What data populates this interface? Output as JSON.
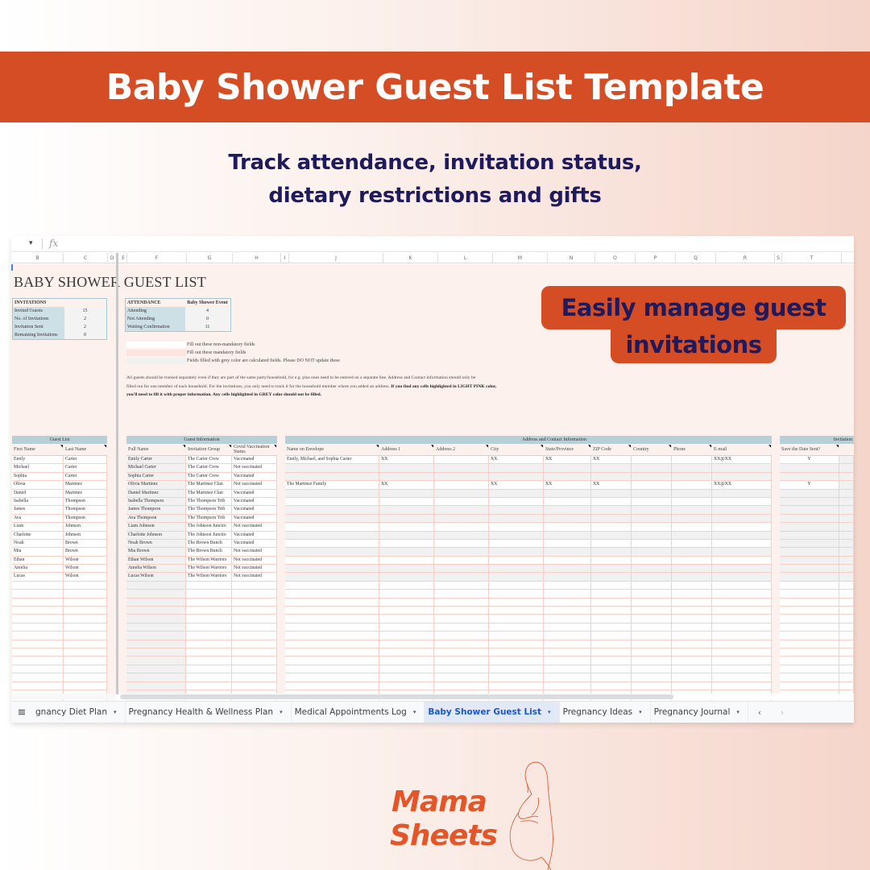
{
  "banner": {
    "title": "Baby Shower Guest List Template"
  },
  "subtitle": {
    "line1": "Track attendance, invitation status,",
    "line2": "dietary restrictions and gifts"
  },
  "callout": {
    "line1": "Easily manage guest",
    "line2": "invitations"
  },
  "colors": {
    "accent": "#d44d25",
    "navy": "#1f1a5c",
    "header_teal": "#b7d0d7",
    "mandatory_pink": "#fde4df",
    "calculated_grey": "#f1f1f1"
  },
  "formula_bar": {
    "fx_label": "fx",
    "namebox_caret": "▾"
  },
  "columns": [
    "B",
    "C",
    "D",
    "E",
    "F",
    "G",
    "H",
    "I",
    "J",
    "K",
    "L",
    "M",
    "N",
    "O",
    "P",
    "Q",
    "R",
    "S",
    "T"
  ],
  "sheet": {
    "title": "BABY SHOWER  GUEST LIST",
    "invitations": {
      "header": "INVITATIONS",
      "rows": [
        {
          "label": "Invited Guests",
          "value": "15"
        },
        {
          "label": "No. of Invitations",
          "value": "2"
        },
        {
          "label": "Invitation Sent",
          "value": "2"
        },
        {
          "label": "Remaining Invitations",
          "value": "0"
        }
      ]
    },
    "attendance": {
      "header": "ATTENDANCE",
      "event": "Baby Shower Event",
      "rows": [
        {
          "label": "Attending",
          "value": "4"
        },
        {
          "label": "Not Attending",
          "value": "0"
        },
        {
          "label": "Waiting Confirmation",
          "value": "11"
        }
      ]
    },
    "legend": [
      "Fill out these non-mandatory fields",
      "Fill out these mandatory fields",
      "Fields filled with grey color are calculated fields. Please DO NOT update these"
    ],
    "note": {
      "line1": "All guests should be tracked separately even if they are part of the same party/household, for e.g. plus ones need to be entered on a separate line. Address and Contact information should only be",
      "line2_plain": "filled out for one member of each household. For the invitations, you only need to track it for the household member where you added an address.",
      "line2_bold": "If you find any cells highlighted in LIGHT PINK color,",
      "line3_bold": "you'll need to fill it with proper information. Any cells highlighted in GREY color should not be filled."
    },
    "guest_list": {
      "title": "Guest List",
      "headers": [
        "First Name",
        "Last Name"
      ],
      "rows": [
        [
          "Emily",
          "Carter"
        ],
        [
          "Michael",
          "Carter"
        ],
        [
          "Sophia",
          "Carter"
        ],
        [
          "Olivia",
          "Martinez"
        ],
        [
          "Daniel",
          "Martinez"
        ],
        [
          "Isabella",
          "Thompson"
        ],
        [
          "James",
          "Thompson"
        ],
        [
          "Ava",
          "Thompson"
        ],
        [
          "Liam",
          "Johnson"
        ],
        [
          "Charlotte",
          "Johnson"
        ],
        [
          "Noah",
          "Brown"
        ],
        [
          "Mia",
          "Brown"
        ],
        [
          "Ethan",
          "Wilson"
        ],
        [
          "Amelia",
          "Wilson"
        ],
        [
          "Lucas",
          "Wilson"
        ]
      ]
    },
    "guest_info": {
      "title": "Guest Information",
      "headers": [
        "Full Name",
        "Invitation Group",
        "Covid Vaccination Status"
      ],
      "rows": [
        [
          "Emily Carter",
          "The Carter Crew",
          "Vaccinated"
        ],
        [
          "Michael Carter",
          "The Carter Crew",
          "Not vaccinated"
        ],
        [
          "Sophia Carter",
          "The Carter Crew",
          "Vaccinated"
        ],
        [
          "Olivia Martinez",
          "The Martinez Clan",
          "Not vaccinated"
        ],
        [
          "Daniel Martinez",
          "The Martinez Clan",
          "Vaccinated"
        ],
        [
          "Isabella Thompson",
          "The Thompson Trib",
          "Vaccinated"
        ],
        [
          "James Thompson",
          "The Thompson Trib",
          "Vaccinated"
        ],
        [
          "Ava Thompson",
          "The Thompson Trib",
          "Vaccinated"
        ],
        [
          "Liam Johnson",
          "The Johnson Junctio",
          "Not vaccinated"
        ],
        [
          "Charlotte Johnson",
          "The Johnson Junctio",
          "Vaccinated"
        ],
        [
          "Noah Brown",
          "The Brown Bunch",
          "Vaccinated"
        ],
        [
          "Mia Brown",
          "The Brown Bunch",
          "Not vaccinated"
        ],
        [
          "Ethan Wilson",
          "The Wilson Warriors",
          "Not vaccinated"
        ],
        [
          "Amelia Wilson",
          "The Wilson Warriors",
          "Not vaccinated"
        ],
        [
          "Lucas Wilson",
          "The Wilson Warriors",
          "Not vaccinated"
        ]
      ]
    },
    "address": {
      "title": "Address and Contact Information",
      "headers": [
        "Name on Envelope",
        "Address 1",
        "Address 2",
        "City",
        "State/Province",
        "ZIP Code",
        "Country",
        "Phone",
        "E-mail"
      ],
      "rows": [
        [
          "Emily, Michael, and Sophia Carter",
          "XX",
          "",
          "XX",
          "XX",
          "XX",
          "",
          "",
          "XX@XX"
        ],
        [
          "",
          "",
          "",
          "",
          "",
          "",
          "",
          "",
          ""
        ],
        [
          "",
          "",
          "",
          "",
          "",
          "",
          "",
          "",
          ""
        ],
        [
          "The Martinez Family",
          "XX",
          "",
          "XX",
          "XX",
          "XX",
          "",
          "",
          "XX@XX"
        ],
        [
          "",
          "",
          "",
          "",
          "",
          "",
          "",
          "",
          ""
        ],
        [
          "",
          "",
          "",
          "",
          "",
          "",
          "",
          "",
          ""
        ],
        [
          "",
          "",
          "",
          "",
          "",
          "",
          "",
          "",
          ""
        ],
        [
          "",
          "",
          "",
          "",
          "",
          "",
          "",
          "",
          ""
        ],
        [
          "",
          "",
          "",
          "",
          "",
          "",
          "",
          "",
          ""
        ],
        [
          "",
          "",
          "",
          "",
          "",
          "",
          "",
          "",
          ""
        ],
        [
          "",
          "",
          "",
          "",
          "",
          "",
          "",
          "",
          ""
        ],
        [
          "",
          "",
          "",
          "",
          "",
          "",
          "",
          "",
          ""
        ],
        [
          "",
          "",
          "",
          "",
          "",
          "",
          "",
          "",
          ""
        ],
        [
          "",
          "",
          "",
          "",
          "",
          "",
          "",
          "",
          ""
        ],
        [
          "",
          "",
          "",
          "",
          "",
          "",
          "",
          "",
          ""
        ]
      ]
    },
    "invitation": {
      "title": "Invitation",
      "headers": [
        "Save the Date Sent?",
        ""
      ],
      "rows": [
        [
          "Y",
          ""
        ],
        [
          "",
          ""
        ],
        [
          "",
          ""
        ],
        [
          "Y",
          ""
        ],
        [
          "",
          ""
        ],
        [
          "",
          ""
        ],
        [
          "",
          ""
        ],
        [
          "",
          ""
        ],
        [
          "",
          ""
        ],
        [
          "",
          ""
        ],
        [
          "",
          ""
        ],
        [
          "",
          ""
        ],
        [
          "",
          ""
        ],
        [
          "",
          ""
        ],
        [
          "",
          ""
        ]
      ]
    }
  },
  "tabs": {
    "items": [
      {
        "label": "gnancy Diet Plan",
        "active": false
      },
      {
        "label": "Pregnancy Health & Wellness Plan",
        "active": false
      },
      {
        "label": "Medical Appointments Log",
        "active": false
      },
      {
        "label": "Baby Shower Guest List",
        "active": true
      },
      {
        "label": "Pregnancy Ideas",
        "active": false
      },
      {
        "label": "Pregnancy Journal",
        "active": false
      }
    ],
    "prev": "‹",
    "next": "›"
  },
  "logo": {
    "line1": "Mama",
    "line2": "Sheets"
  }
}
